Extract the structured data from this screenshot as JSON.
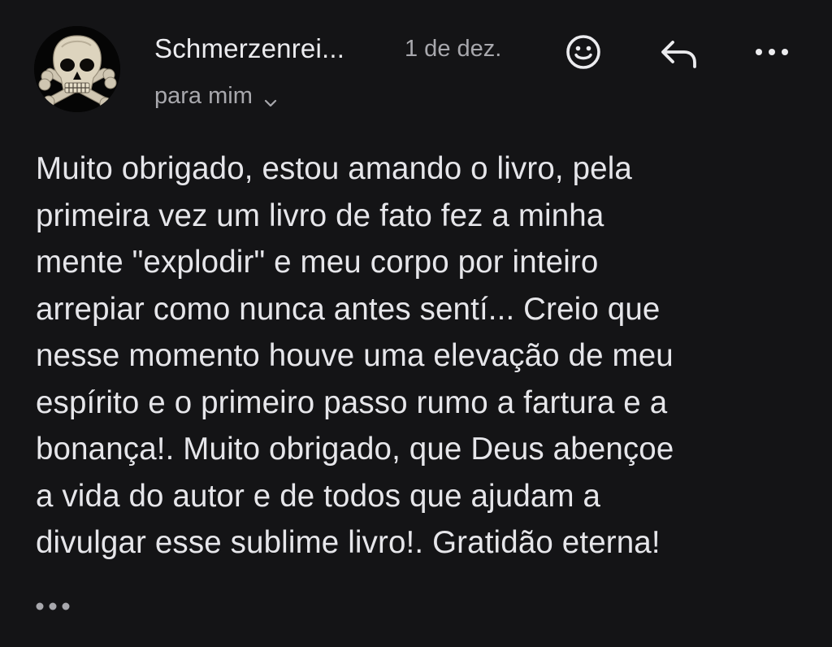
{
  "header": {
    "sender_name": "Schmerzenrei...",
    "date": "1 de dez.",
    "recipient": "para mim",
    "avatar_icon": "skull-icon",
    "actions": {
      "emoji_icon": "emoji-smile-icon",
      "reply_icon": "reply-arrow-icon",
      "more_icon": "more-horizontal-icon"
    }
  },
  "message": {
    "lines": [
      "Muito obrigado, estou amando o livro, pela",
      "primeira vez um livro de fato fez a minha",
      "mente \"explodir\" e meu corpo por inteiro",
      "arrepiar como nunca antes sentí... Creio que",
      "nesse momento houve uma elevação de meu",
      "espírito e o primeiro passo rumo a fartura e a",
      "bonança!. Muito obrigado, que Deus abençoe",
      "a vida do autor e de todos que ajudam a",
      "divulgar esse sublime livro!. Gratidão eterna!"
    ],
    "trimmed_content_icon": "ellipsis-icon"
  },
  "colors": {
    "background": "#141416",
    "primary_text": "#e9e9ec",
    "secondary_text": "#a8a8ad"
  }
}
